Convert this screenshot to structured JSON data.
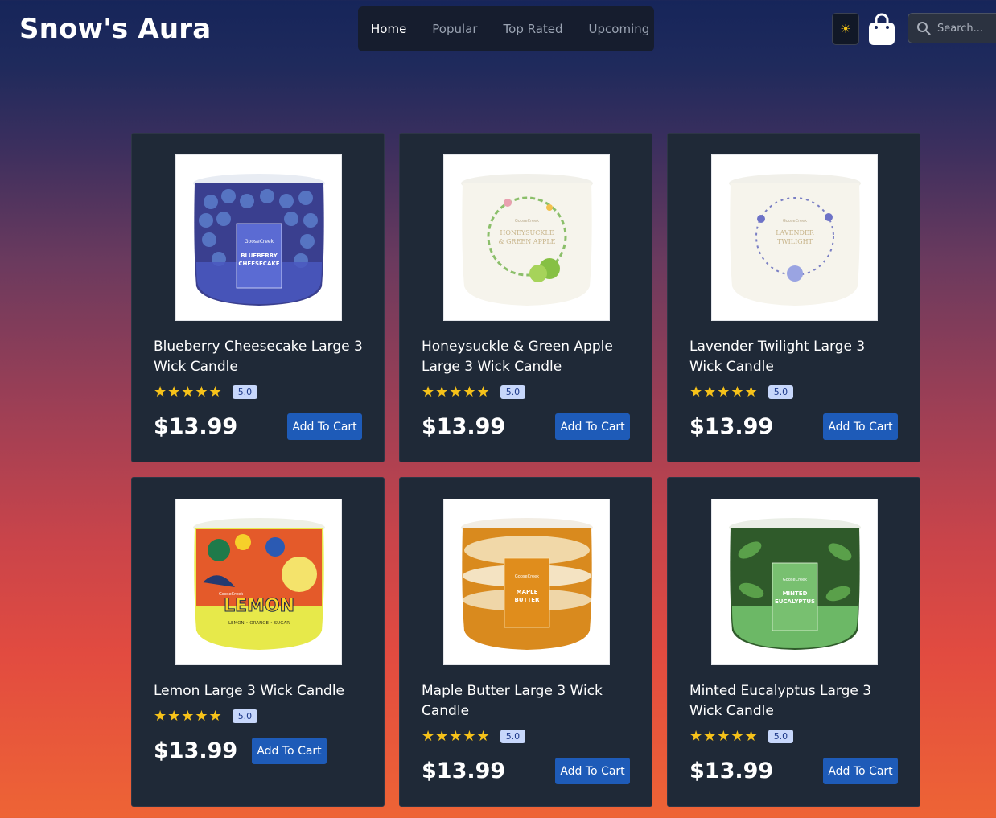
{
  "header": {
    "brand": "Snow's Aura",
    "nav": [
      "Home",
      "Popular",
      "Top Rated",
      "Upcoming"
    ],
    "active_nav": "Home",
    "theme_icon": "sun-icon",
    "cart_icon": "shopping-bag-icon",
    "search_placeholder": "Search..."
  },
  "products": [
    {
      "title": "Blueberry Cheesecake Large 3 Wick Candle",
      "rating": "5.0",
      "price": "$13.99",
      "button": "Add To Cart",
      "image_label": "BLUEBERRY CHEESECAKE",
      "brand_mark": "GooseCreek"
    },
    {
      "title": "Honeysuckle & Green Apple Large 3 Wick Candle",
      "rating": "5.0",
      "price": "$13.99",
      "button": "Add To Cart",
      "image_label": "HONEYSUCKLE & GREEN APPLE",
      "brand_mark": "GooseCreek"
    },
    {
      "title": "Lavender Twilight Large 3 Wick Candle",
      "rating": "5.0",
      "price": "$13.99",
      "button": "Add To Cart",
      "image_label": "LAVENDER TWILIGHT",
      "brand_mark": "GooseCreek"
    },
    {
      "title": "Lemon Large 3 Wick Candle",
      "rating": "5.0",
      "price": "$13.99",
      "button": "Add To Cart",
      "image_label": "LEMON",
      "brand_mark": "GooseCreek"
    },
    {
      "title": "Maple Butter Large 3 Wick Candle",
      "rating": "5.0",
      "price": "$13.99",
      "button": "Add To Cart",
      "image_label": "MAPLE BUTTER",
      "brand_mark": "GooseCreek"
    },
    {
      "title": "Minted Eucalyptus Large 3 Wick Candle",
      "rating": "5.0",
      "price": "$13.99",
      "button": "Add To Cart",
      "image_label": "MINTED EUCALYPTUS",
      "brand_mark": "GooseCreek"
    }
  ],
  "colors": {
    "card_bg": "#1f2937",
    "button_bg": "#1e5bb8",
    "star": "#f6c21a",
    "badge_bg": "#c7d7fb"
  }
}
